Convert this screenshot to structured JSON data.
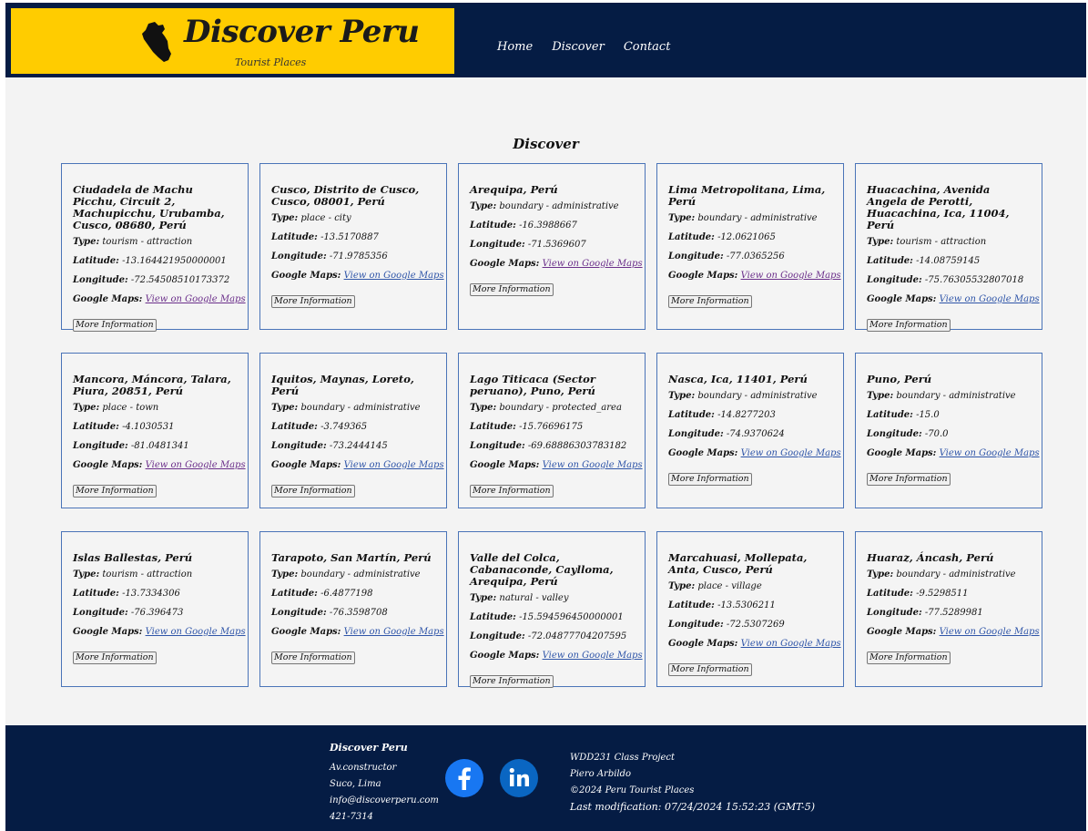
{
  "brand": {
    "title": "Discover Peru",
    "subtitle": "Tourist Places"
  },
  "nav": [
    "Home",
    "Discover",
    "Contact"
  ],
  "page_title": "Discover",
  "labels": {
    "type": "Type:",
    "lat": "Latitude:",
    "lon": "Longitude:",
    "maps": "Google Maps:",
    "link": "View on Google Maps",
    "button": "More Information"
  },
  "places": [
    {
      "name": "Ciudadela de Machu Picchu, Circuit 2, Machupicchu, Urubamba, Cusco, 08680, Perú",
      "type": "tourism - attraction",
      "lat": "-13.164421950000001",
      "lon": "-72.54508510173372",
      "visited": true
    },
    {
      "name": "Cusco, Distrito de Cusco, Cusco, 08001, Perú",
      "type": "place - city",
      "lat": "-13.5170887",
      "lon": "-71.9785356",
      "visited": false
    },
    {
      "name": "Arequipa, Perú",
      "type": "boundary - administrative",
      "lat": "-16.3988667",
      "lon": "-71.5369607",
      "visited": true
    },
    {
      "name": "Lima Metropolitana, Lima, Perú",
      "type": "boundary - administrative",
      "lat": "-12.0621065",
      "lon": "-77.0365256",
      "visited": true
    },
    {
      "name": "Huacachina, Avenida Angela de Perotti, Huacachina, Ica, 11004, Perú",
      "type": "tourism - attraction",
      "lat": "-14.08759145",
      "lon": "-75.76305532807018",
      "visited": false
    },
    {
      "name": "Mancora, Máncora, Talara, Piura, 20851, Perú",
      "type": "place - town",
      "lat": "-4.1030531",
      "lon": "-81.0481341",
      "visited": true
    },
    {
      "name": "Iquitos, Maynas, Loreto, Perú",
      "type": "boundary - administrative",
      "lat": "-3.749365",
      "lon": "-73.2444145",
      "visited": false
    },
    {
      "name": "Lago Titicaca (Sector peruano), Puno, Perú",
      "type": "boundary - protected_area",
      "lat": "-15.76696175",
      "lon": "-69.68886303783182",
      "visited": false
    },
    {
      "name": "Nasca, Ica, 11401, Perú",
      "type": "boundary - administrative",
      "lat": "-14.8277203",
      "lon": "-74.9370624",
      "visited": false
    },
    {
      "name": "Puno, Perú",
      "type": "boundary - administrative",
      "lat": "-15.0",
      "lon": "-70.0",
      "visited": false
    },
    {
      "name": "Islas Ballestas, Perú",
      "type": "tourism - attraction",
      "lat": "-13.7334306",
      "lon": "-76.396473",
      "visited": false
    },
    {
      "name": "Tarapoto, San Martín, Perú",
      "type": "boundary - administrative",
      "lat": "-6.4877198",
      "lon": "-76.3598708",
      "visited": false
    },
    {
      "name": "Valle del Colca, Cabanaconde, Caylloma, Arequipa, Perú",
      "type": "natural - valley",
      "lat": "-15.594596450000001",
      "lon": "-72.04877704207595",
      "visited": false
    },
    {
      "name": "Marcahuasi, Mollepata, Anta, Cusco, Perú",
      "type": "place - village",
      "lat": "-13.5306211",
      "lon": "-72.5307269",
      "visited": false
    },
    {
      "name": "Huaraz, Áncash, Perú",
      "type": "boundary - administrative",
      "lat": "-9.5298511",
      "lon": "-77.5289981",
      "visited": false
    }
  ],
  "footer": {
    "name": "Discover Peru",
    "address1": "Av.constructor",
    "address2": "Suco, Lima",
    "email": "info@discoverperu.com",
    "phone": "421-7314",
    "course": "WDD231 Class Project",
    "author": "Piero Arbildo",
    "copyright": "©2024 Peru Tourist Places",
    "last_modified": "Last modification: 07/24/2024 15:52:23 (GMT-5)"
  },
  "colors": {
    "header_bg": "#051c44",
    "brand_bg": "#ffcc00",
    "card_border": "#4a74b8",
    "facebook": "#1877f2",
    "linkedin": "#0a66c2"
  },
  "icons": {
    "brand": "peru-map-icon",
    "social": [
      "facebook-icon",
      "linkedin-icon"
    ]
  }
}
